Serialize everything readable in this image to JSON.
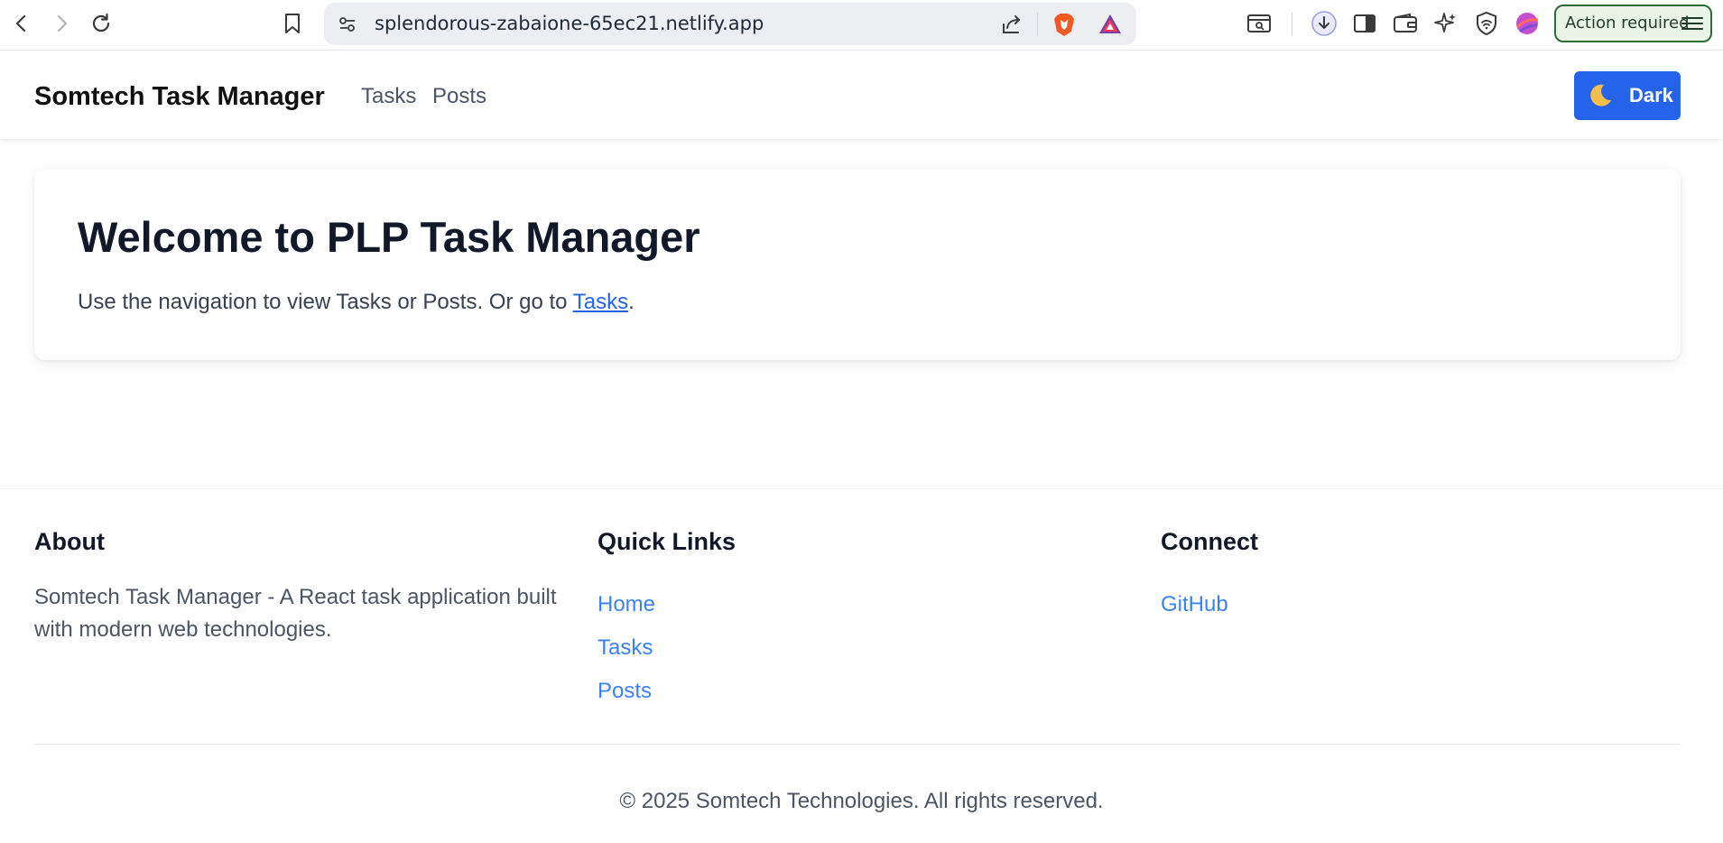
{
  "browser": {
    "url": "splendorous-zabaione-65ec21.netlify.app",
    "action_button_label": "Action required",
    "icons": [
      "back-icon",
      "forward-icon",
      "reload-icon",
      "bookmark-icon",
      "site-settings-icon",
      "share-icon",
      "brave-shields-icon",
      "brave-rewards-icon",
      "reader-mode-icon",
      "download-icon",
      "sidebar-icon",
      "wallet-icon",
      "leo-ai-icon",
      "vpn-icon",
      "profile-icon",
      "menu-icon"
    ]
  },
  "navbar": {
    "brand": "Somtech Task Manager",
    "links": [
      "Tasks",
      "Posts"
    ],
    "theme_button": {
      "icon": "moon-icon",
      "label": "Dark"
    }
  },
  "card": {
    "title": "Welcome to PLP Task Manager",
    "text_before_link": "Use the navigation to view Tasks or Posts. Or go to ",
    "link_text": "Tasks",
    "text_after_link": "."
  },
  "footer": {
    "about": {
      "heading": "About",
      "text": "Somtech Task Manager - A React task application built with modern web technologies."
    },
    "quick_links": {
      "heading": "Quick Links",
      "links": [
        "Home",
        "Tasks",
        "Posts"
      ]
    },
    "connect": {
      "heading": "Connect",
      "links": [
        "GitHub"
      ]
    },
    "copyright": "© 2025 Somtech Technologies. All rights reserved."
  },
  "colors": {
    "primary": "#2563eb",
    "link": "#3b82f6",
    "heading": "#111827",
    "muted": "#4b5563",
    "action_border": "#2f6b3a"
  }
}
